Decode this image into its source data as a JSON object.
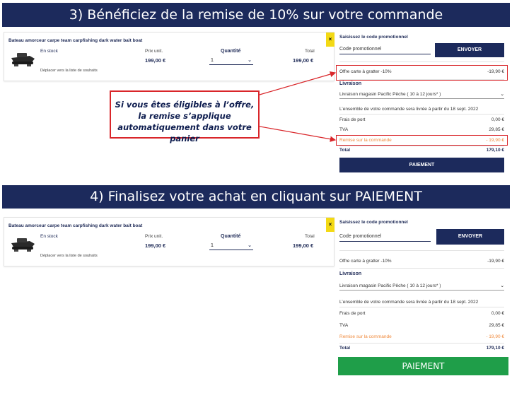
{
  "banners": {
    "step3": "3) Bénéficiez de la remise de 10% sur votre commande",
    "step4": "4) Finalisez votre achat en cliquant sur PAIEMENT"
  },
  "callout": {
    "text": "Si vous êtes éligibles à l’offre, la remise s’applique automatiquement dans votre panier"
  },
  "cart": {
    "product_name": "Bateau amorceur carpe team carpfishing dark water bait boat",
    "stock": "En stock",
    "wishlist": "Déplacer vers la liste de souhaits",
    "unit_price_label": "Prix unit.",
    "unit_price": "199,00 €",
    "quantity_label": "Quantité",
    "quantity": "1",
    "total_label": "Total",
    "total": "199,00 €",
    "close": "×"
  },
  "summary": {
    "promo_label": "Saisissez le code promotionnel",
    "promo_placeholder": "Code promotionnel",
    "send_button": "ENVOYER",
    "offer_label": "Offre carte à gratter -10%",
    "offer_value": "-19,90 €",
    "delivery_title": "Livraison",
    "delivery_option": "Livraison magasin Pacific Pêche ( 10 à 12 jours* )",
    "delivery_note": "L’ensemble de votre commande sera livrée à partir du 18 sept. 2022",
    "shipping_label": "Frais de port",
    "shipping_value": "0,00 €",
    "tva_label": "TVA",
    "tva_value": "29,85 €",
    "discount_label": "Remise sur la commande",
    "discount_value": "- 19,90 €",
    "total_label": "Total",
    "total_value": "179,10 €",
    "pay_button": "PAIEMENT"
  },
  "colors": {
    "navy": "#1c2a5c",
    "highlight_red": "#d9262a",
    "pay_green": "#1f9e49",
    "discount_orange": "#f08a3c",
    "close_yellow": "#f3d914"
  }
}
